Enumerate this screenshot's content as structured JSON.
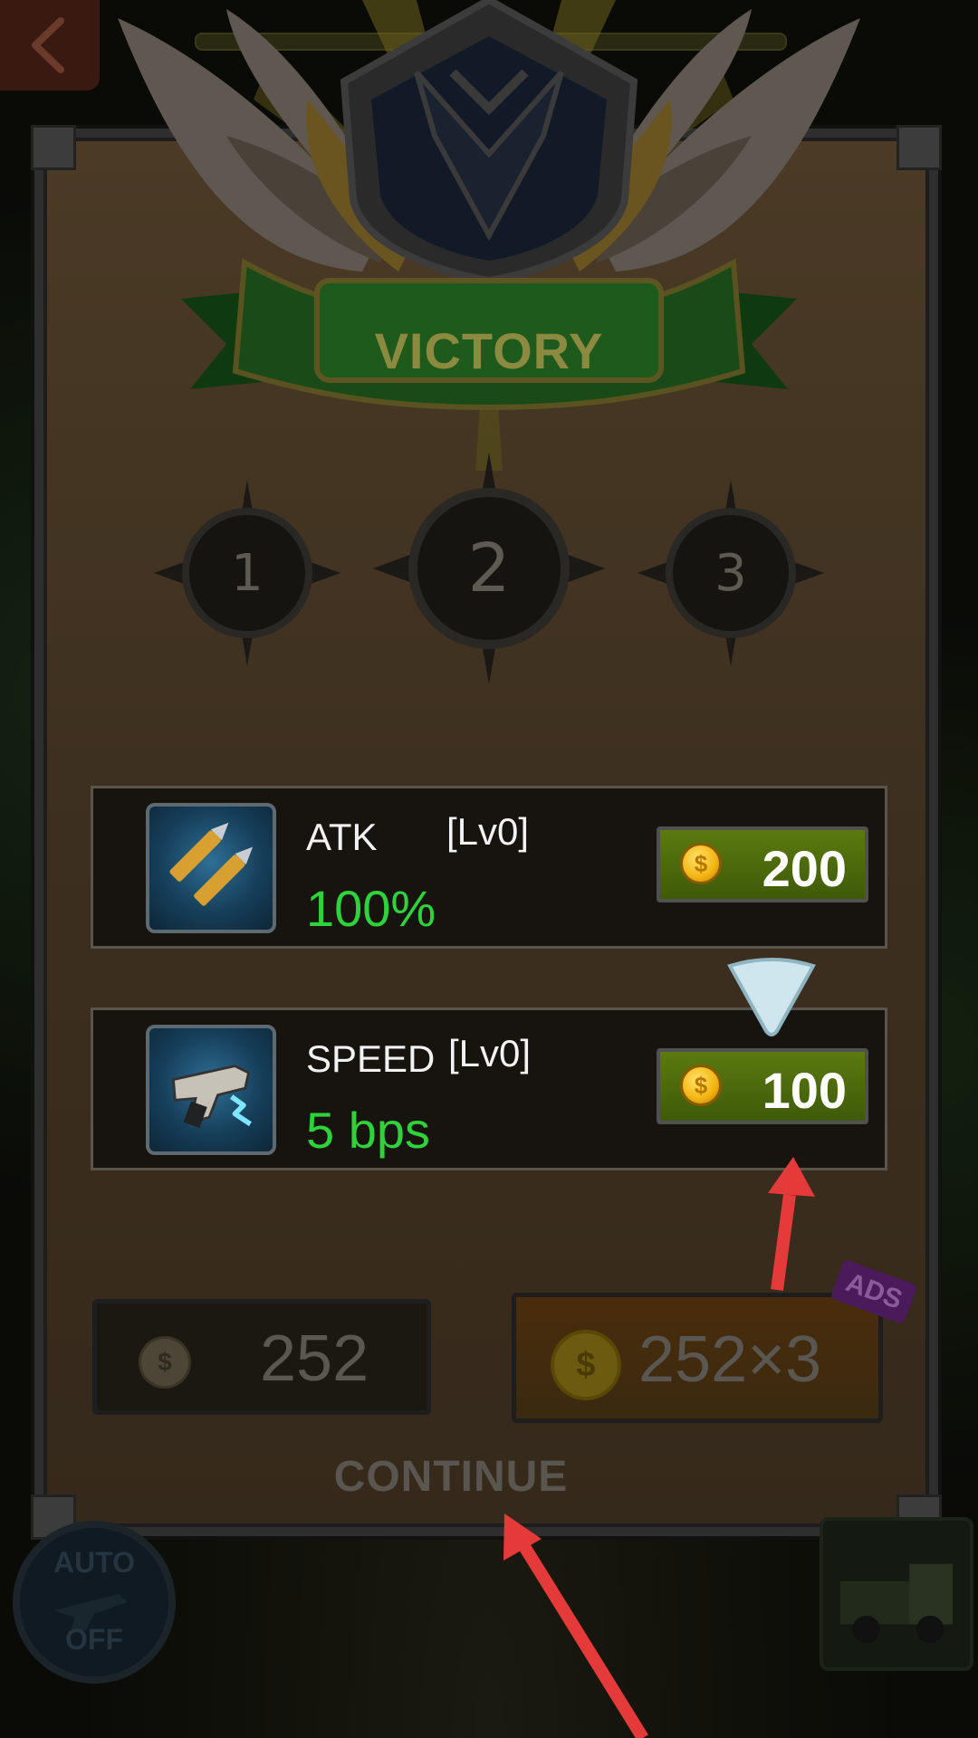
{
  "banner": {
    "title": "VICTORY"
  },
  "stars": {
    "labels": [
      "1",
      "2",
      "3"
    ]
  },
  "upgrades": [
    {
      "name": "ATK",
      "level": "[Lv0]",
      "value": "100%",
      "cost": "200",
      "icon": "bullets-icon"
    },
    {
      "name": "SPEED",
      "level": "[Lv0]",
      "value": "5 bps",
      "cost": "100",
      "icon": "blaster-gun-icon"
    }
  ],
  "rewards": {
    "single_value": "252",
    "triple_value": "252×3",
    "ads_badge": "ADS"
  },
  "actions": {
    "continue_label": "CONTINUE"
  },
  "hud": {
    "auto_top": "AUTO",
    "auto_bottom": "OFF"
  },
  "colors": {
    "stat_green": "#2fd23a",
    "cost_button": "#4e6a0c",
    "annotation_arrow": "#e53a3a",
    "panel": "#3d2f1f"
  }
}
